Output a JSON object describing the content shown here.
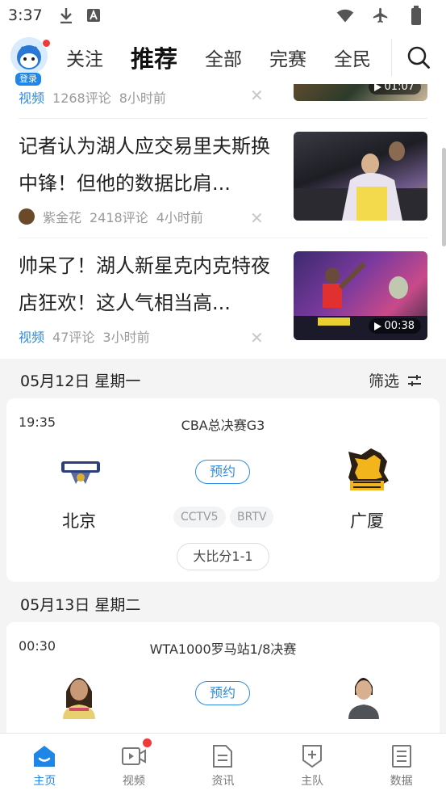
{
  "status_bar": {
    "time": "3:37"
  },
  "top_nav": {
    "login_label": "登录",
    "tabs": [
      {
        "label": "关注"
      },
      {
        "label": "推荐"
      },
      {
        "label": "全部"
      },
      {
        "label": "完赛"
      },
      {
        "label": "全民"
      }
    ]
  },
  "articles": [
    {
      "tag": "视频",
      "comments": "1268评论",
      "time": "8小时前",
      "duration": "01:07"
    },
    {
      "title": "记者认为湖人应交易里夫斯换中锋！但他的数据比肩...",
      "author": "紫金花",
      "comments": "2418评论",
      "time": "4小时前"
    },
    {
      "title": "帅呆了！湖人新星克内克特夜店狂欢！这人气相当高...",
      "tag": "视频",
      "comments": "47评论",
      "time": "3小时前",
      "duration": "00:38"
    }
  ],
  "schedule": {
    "filter_label": "筛选",
    "days": [
      {
        "date": "05月12日 星期一",
        "match": {
          "time": "19:35",
          "title": "CBA总决赛G3",
          "home": "北京",
          "away": "广厦",
          "reserve": "预约",
          "channels": [
            "CCTV5",
            "BRTV"
          ],
          "series_score": "大比分1-1"
        }
      },
      {
        "date": "05月13日 星期二",
        "match": {
          "time": "00:30",
          "title": "WTA1000罗马站1/8决赛",
          "reserve": "预约"
        }
      }
    ]
  },
  "bottom_nav": [
    {
      "label": "主页",
      "icon": "home-icon"
    },
    {
      "label": "视频",
      "icon": "video-icon"
    },
    {
      "label": "资讯",
      "icon": "news-icon"
    },
    {
      "label": "主队",
      "icon": "team-icon"
    },
    {
      "label": "数据",
      "icon": "data-icon"
    }
  ],
  "colors": {
    "accent": "#1e86e6",
    "badge": "#f03a3a"
  }
}
